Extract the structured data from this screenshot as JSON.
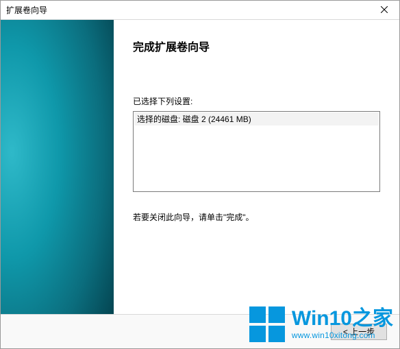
{
  "window": {
    "title": "扩展卷向导"
  },
  "main": {
    "heading": "完成扩展卷向导",
    "settings_label": "已选择下列设置:",
    "settings_rows": [
      "选择的磁盘: 磁盘 2 (24461 MB)"
    ],
    "instruction": "若要关闭此向导，请单击\"完成\"。"
  },
  "footer": {
    "back_label": "< 上一步"
  },
  "watermark": {
    "brand_line1": "Win10之家",
    "brand_line2": "www.win10xitong.com"
  }
}
